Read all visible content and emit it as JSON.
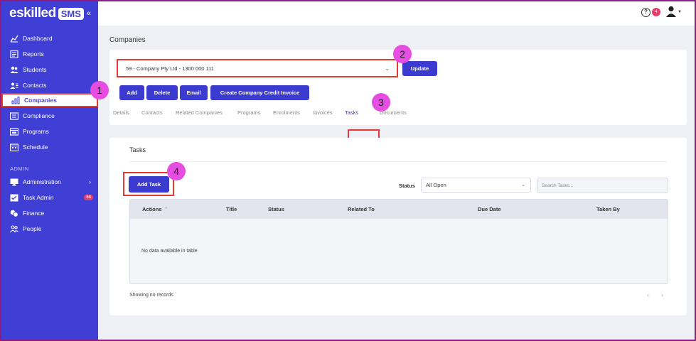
{
  "brand": {
    "logo_text": "eskilled",
    "logo_badge": "SMS",
    "collapse_icon": "«"
  },
  "sidebar": {
    "items": [
      {
        "label": "Dashboard",
        "icon": "chart-line-icon"
      },
      {
        "label": "Reports",
        "icon": "report-icon"
      },
      {
        "label": "Students",
        "icon": "users-icon"
      },
      {
        "label": "Contacts",
        "icon": "contact-card-icon"
      },
      {
        "label": "Companies",
        "icon": "bar-chart-icon"
      },
      {
        "label": "Compliance",
        "icon": "id-card-icon"
      },
      {
        "label": "Programs",
        "icon": "window-icon"
      },
      {
        "label": "Schedule",
        "icon": "calendar-icon"
      }
    ],
    "section_label": "ADMIN",
    "admin_items": [
      {
        "label": "Administration",
        "icon": "monitor-icon"
      },
      {
        "label": "Task Admin",
        "icon": "tasks-icon",
        "badge": "66"
      },
      {
        "label": "Finance",
        "icon": "coins-icon"
      },
      {
        "label": "People",
        "icon": "people-icon"
      }
    ]
  },
  "topbar": {
    "help_icon": "?",
    "help_badge": "4"
  },
  "page": {
    "title": "Companies"
  },
  "company": {
    "selected": "59 - Company Pty Ltd - 1300 000 111",
    "update_label": "Update",
    "buttons": [
      "Add",
      "Delete",
      "Email",
      "Create Company Credit Invoice"
    ],
    "tabs": [
      "Details",
      "Contacts",
      "Related Companies",
      "Programs",
      "Enrolments",
      "Invoices",
      "Tasks",
      "Documents"
    ]
  },
  "tasks": {
    "title": "Tasks",
    "add_label": "Add Task",
    "status_label": "Status",
    "status_value": "All Open",
    "search_placeholder": "Search Tasks...",
    "columns": [
      "Actions",
      "Title",
      "Status",
      "Related To",
      "Due Date",
      "Taken By"
    ],
    "empty_text": "No data available in table",
    "footer": "Showing no records",
    "pager_prev": "‹",
    "pager_next": "›"
  },
  "callouts": [
    "1",
    "2",
    "3",
    "4"
  ],
  "colors": {
    "primary": "#3f3fd6",
    "highlight": "#e53935",
    "callout": "#e54ee0",
    "badge": "#e53e6e"
  }
}
